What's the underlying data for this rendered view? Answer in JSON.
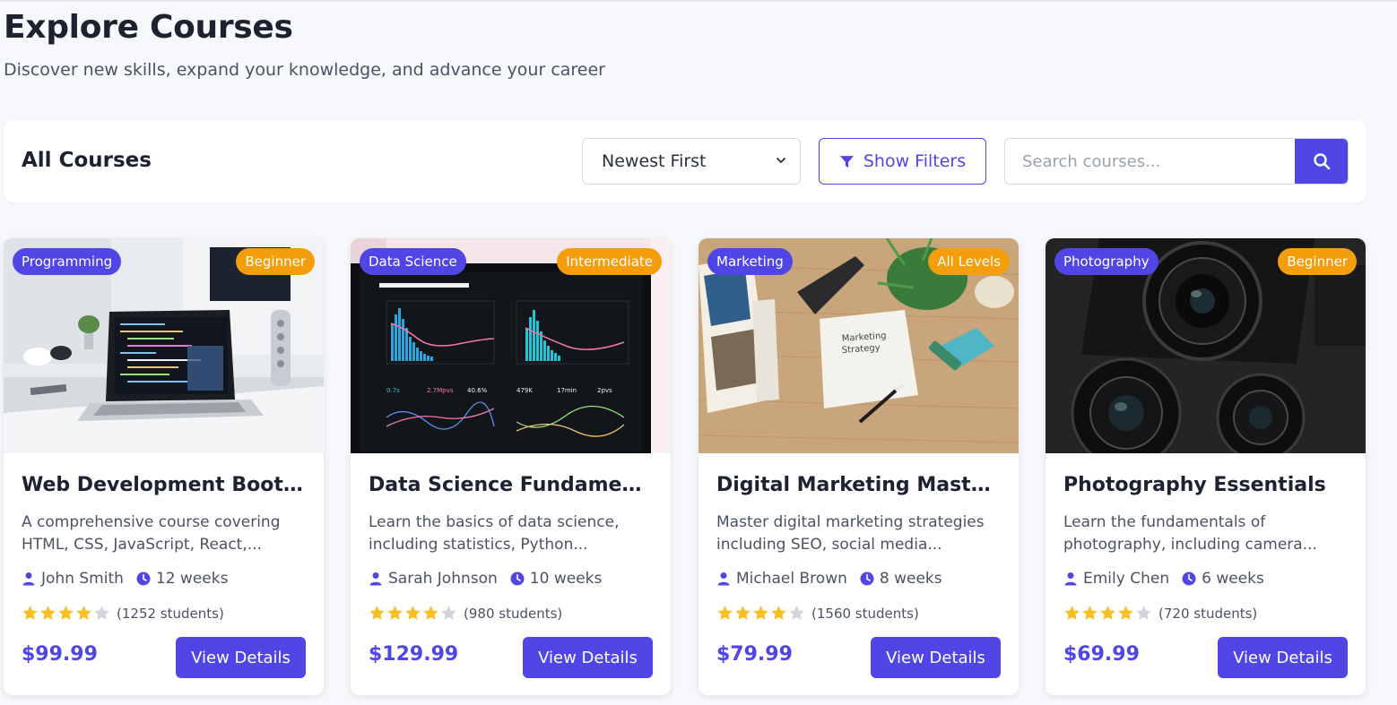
{
  "header": {
    "title": "Explore Courses",
    "subtitle": "Discover new skills, expand your knowledge, and advance your career"
  },
  "toolbar": {
    "title": "All Courses",
    "sort_value": "Newest First",
    "filters_label": "Show Filters",
    "search_placeholder": "Search courses..."
  },
  "courses": [
    {
      "category": "Programming",
      "level": "Beginner",
      "title": "Web Development Bootc...",
      "description": "A comprehensive course covering HTML, CSS, JavaScript, React,...",
      "instructor": "John Smith",
      "duration": "12 weeks",
      "rating": 4,
      "students": "(1252 students)",
      "price": "$99.99",
      "button": "View Details"
    },
    {
      "category": "Data Science",
      "level": "Intermediate",
      "title": "Data Science Fundament...",
      "description": "Learn the basics of data science, including statistics, Python...",
      "instructor": "Sarah Johnson",
      "duration": "10 weeks",
      "rating": 4,
      "students": "(980 students)",
      "price": "$129.99",
      "button": "View Details"
    },
    {
      "category": "Marketing",
      "level": "All Levels",
      "title": "Digital Marketing Master...",
      "description": "Master digital marketing strategies including SEO, social media...",
      "instructor": "Michael Brown",
      "duration": "8 weeks",
      "rating": 4,
      "students": "(1560 students)",
      "price": "$79.99",
      "button": "View Details"
    },
    {
      "category": "Photography",
      "level": "Beginner",
      "title": "Photography Essentials",
      "description": "Learn the fundamentals of photography, including camera...",
      "instructor": "Emily Chen",
      "duration": "6 weeks",
      "rating": 4,
      "students": "(720 students)",
      "price": "$69.99",
      "button": "View Details"
    }
  ],
  "colors": {
    "accent": "#4f46e5",
    "level_badge": "#f59e0b",
    "star_filled": "#fbbf24",
    "star_empty": "#d1d5db"
  },
  "icons": {
    "sort": "chevron-down-icon",
    "filter": "filter-icon",
    "search": "search-icon",
    "instructor": "user-icon",
    "duration": "clock-icon",
    "rating": "star-icon"
  }
}
